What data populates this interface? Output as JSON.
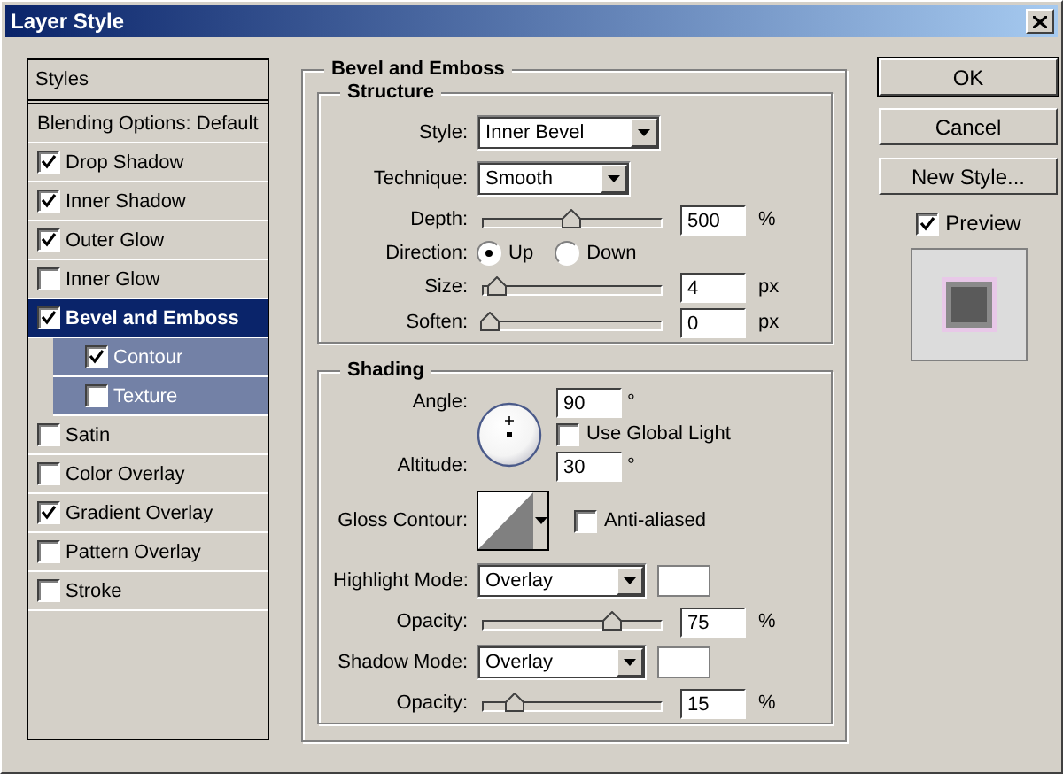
{
  "window": {
    "title": "Layer Style"
  },
  "styles_panel": {
    "header": "Styles",
    "items": [
      {
        "label": "Blending Options: Default",
        "kind": "plain",
        "selected": false
      },
      {
        "label": "Drop Shadow",
        "kind": "check",
        "checked": true,
        "selected": false
      },
      {
        "label": "Inner Shadow",
        "kind": "check",
        "checked": true,
        "selected": false
      },
      {
        "label": "Outer Glow",
        "kind": "check",
        "checked": true,
        "selected": false
      },
      {
        "label": "Inner Glow",
        "kind": "check",
        "checked": false,
        "selected": false
      },
      {
        "label": "Bevel and Emboss",
        "kind": "check",
        "checked": true,
        "selected": true,
        "children": [
          {
            "label": "Contour",
            "kind": "check",
            "checked": true,
            "selected": false
          },
          {
            "label": "Texture",
            "kind": "check",
            "checked": false,
            "selected": false
          }
        ]
      },
      {
        "label": "Satin",
        "kind": "check",
        "checked": false,
        "selected": false
      },
      {
        "label": "Color Overlay",
        "kind": "check",
        "checked": false,
        "selected": false
      },
      {
        "label": "Gradient Overlay",
        "kind": "check",
        "checked": true,
        "selected": false
      },
      {
        "label": "Pattern Overlay",
        "kind": "check",
        "checked": false,
        "selected": false
      },
      {
        "label": "Stroke",
        "kind": "check",
        "checked": false,
        "selected": false
      }
    ]
  },
  "bevel_and_emboss": {
    "title": "Bevel and Emboss",
    "structure": {
      "title": "Structure",
      "style": {
        "label": "Style:",
        "value": "Inner Bevel"
      },
      "technique": {
        "label": "Technique:",
        "value": "Smooth"
      },
      "depth": {
        "label": "Depth:",
        "level": 0.5,
        "value": "500",
        "unit": "%"
      },
      "direction": {
        "label": "Direction:",
        "options": [
          {
            "label": "Up",
            "selected": true
          },
          {
            "label": "Down",
            "selected": false
          }
        ]
      },
      "size": {
        "label": "Size:",
        "level": 0.04,
        "value": "4",
        "unit": "px"
      },
      "soften": {
        "label": "Soften:",
        "level": 0,
        "value": "0",
        "unit": "px"
      }
    },
    "shading": {
      "title": "Shading",
      "angle": {
        "label": "Angle:",
        "value": "90",
        "unit": "°"
      },
      "use_global_light": {
        "label": "Use Global Light",
        "checked": false
      },
      "altitude": {
        "label": "Altitude:",
        "value": "30",
        "unit": "°"
      },
      "gloss_contour": {
        "label": "Gloss Contour:"
      },
      "anti_aliased": {
        "label": "Anti-aliased",
        "checked": false
      },
      "highlight_mode": {
        "label": "Highlight Mode:",
        "value": "Overlay"
      },
      "highlight_opacity": {
        "label": "Opacity:",
        "level": 0.75,
        "value": "75",
        "unit": "%"
      },
      "shadow_mode": {
        "label": "Shadow Mode:",
        "value": "Overlay"
      },
      "shadow_opacity": {
        "label": "Opacity:",
        "level": 0.15,
        "value": "15",
        "unit": "%"
      }
    }
  },
  "buttons": [
    {
      "label": "OK",
      "default": true
    },
    {
      "label": "Cancel",
      "default": false
    },
    {
      "label": "New Style...",
      "default": false
    }
  ],
  "preview": {
    "label": "Preview",
    "checked": true
  }
}
